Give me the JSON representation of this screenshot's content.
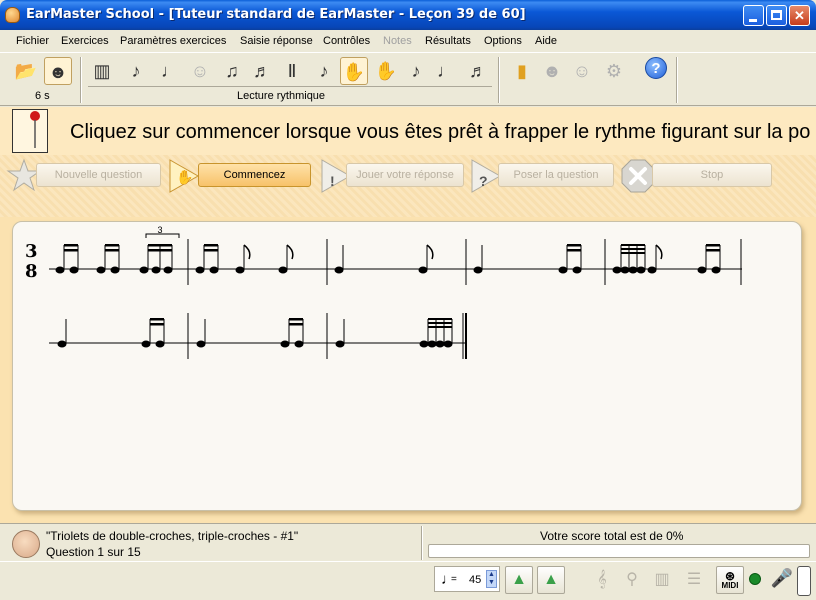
{
  "window": {
    "title": "EarMaster School - [Tuteur standard de EarMaster - Leçon 39 de 60]",
    "minimize_glyph": "",
    "maximize_glyph": "",
    "close_glyph": "✕"
  },
  "menu": [
    {
      "label": "Fichier",
      "enabled": true
    },
    {
      "label": "Exercices",
      "enabled": true
    },
    {
      "label": "Paramètres exercices",
      "enabled": true
    },
    {
      "label": "Saisie réponse",
      "enabled": true
    },
    {
      "label": "Contrôles",
      "enabled": true
    },
    {
      "label": "Notes",
      "enabled": false
    },
    {
      "label": "Résultats",
      "enabled": true
    },
    {
      "label": "Options",
      "enabled": true
    },
    {
      "label": "Aide",
      "enabled": true
    }
  ],
  "toolbar": {
    "timer_label": "6 s",
    "exercise_group_label": "Lecture rythmique",
    "help_glyph": "?"
  },
  "instruction": "Cliquez sur commencer lorsque vous êtes prêt à frapper le rythme figurant sur la po",
  "actions": {
    "new_question": "Nouvelle question",
    "start": "Commencez",
    "play_answer": "Jouer votre réponse",
    "ask_question": "Poser la question",
    "stop": "Stop"
  },
  "score": {
    "time_signature": {
      "top": "3",
      "bottom": "8"
    },
    "tuplet_label": "3"
  },
  "status": {
    "lesson_name": "\"Triolets de double-croches, triple-croches - #1\"",
    "question": "Question 1 sur 15",
    "total_score": "Votre score total est de 0%",
    "progress_fraction": 0.0
  },
  "bottom": {
    "tempo_equals": "=",
    "tempo_value": "45",
    "midi_label": "MIDI"
  },
  "colors": {
    "accent": "#f7c26a",
    "instruction_bg": "#fde9c0",
    "midi_indicator": "#1a8a2a"
  }
}
